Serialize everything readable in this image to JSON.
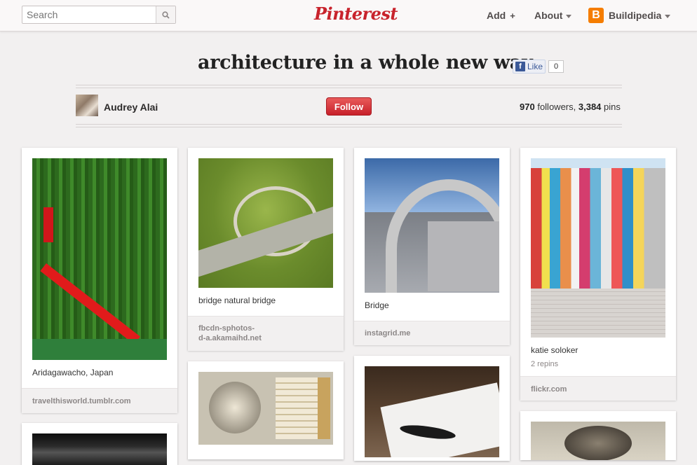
{
  "header": {
    "search_placeholder": "Search",
    "logo": "Pinterest",
    "nav_add": "Add",
    "nav_add_icon": "+",
    "nav_about": "About",
    "user_initial": "B",
    "user_name": "Buildipedia"
  },
  "board": {
    "title": "architecture in a whole new way",
    "fb_like": "Like",
    "fb_count": "0",
    "owner_name": "Audrey Alai",
    "follow_label": "Follow",
    "followers_count": "970",
    "followers_label": "followers,",
    "pins_count": "3,384",
    "pins_label": "pins"
  },
  "pins": [
    {
      "description": "Aridagawacho, Japan",
      "source": "travelthisworld.tumblr.com",
      "image": "red-suspension-bridge-forest"
    },
    {
      "description": "bridge natural bridge",
      "source_line1": "fbcdn-sphotos-",
      "source_line2": "d-a.akamaihd.net",
      "image": "aerial-green-bridge-highway"
    },
    {
      "description": "Bridge",
      "source": "instagrid.me",
      "image": "riveted-steel-arch-bridge"
    },
    {
      "description": "katie soloker",
      "repins": "2 repins",
      "source": "flickr.com",
      "image": "painted-drips-wall"
    },
    {
      "image": "watch-and-matchbox"
    },
    {
      "image": "bird-drawing-paper"
    },
    {
      "image": "dark-interior"
    },
    {
      "image": "framed-portrait"
    }
  ],
  "colors": {
    "brand": "#c8232c",
    "follow": "#d12b31",
    "fb": "#3b5998",
    "background": "#f2f0f0"
  }
}
